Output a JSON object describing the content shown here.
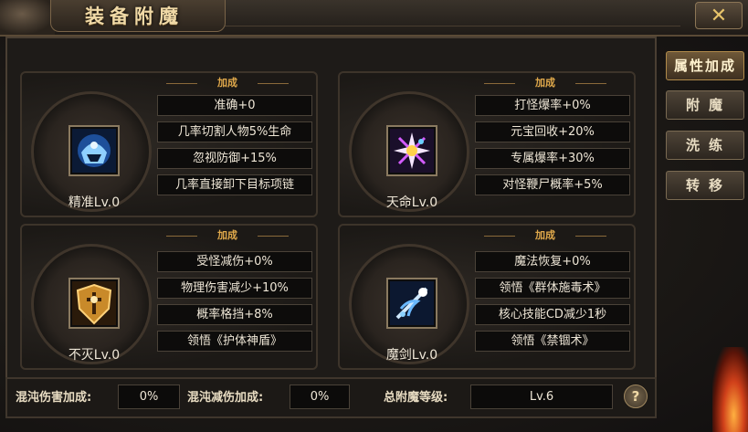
{
  "window": {
    "title": "装备附魔",
    "close_icon": "close-x-icon"
  },
  "side_tabs": [
    {
      "label": "属性加成",
      "active": true
    },
    {
      "label": "附魔",
      "active": false
    },
    {
      "label": "洗练",
      "active": false
    },
    {
      "label": "转移",
      "active": false
    }
  ],
  "panels": [
    {
      "header": "加成",
      "name": "精准Lv.0",
      "icon": "precision-helmet-icon",
      "stats": [
        "准确+0",
        "几率切割人物5%生命",
        "忽视防御+15%",
        "几率直接卸下目标项链"
      ]
    },
    {
      "header": "加成",
      "name": "天命Lv.0",
      "icon": "destiny-star-icon",
      "stats": [
        "打怪爆率+0%",
        "元宝回收+20%",
        "专属爆率+30%",
        "对怪鞭尸概率+5%"
      ]
    },
    {
      "header": "加成",
      "name": "不灭Lv.0",
      "icon": "immortal-shield-icon",
      "stats": [
        "受怪减伤+0%",
        "物理伤害减少+10%",
        "概率格挡+8%",
        "领悟《护体神盾》"
      ]
    },
    {
      "header": "加成",
      "name": "魔剑Lv.0",
      "icon": "magic-sword-icon",
      "stats": [
        "魔法恢复+0%",
        "领悟《群体施毒术》",
        "核心技能CD减少1秒",
        "领悟《禁锢术》"
      ]
    }
  ],
  "bottom": {
    "chaos_damage_label": "混沌伤害加成:",
    "chaos_damage_value": "0%",
    "chaos_reduce_label": "混沌减伤加成:",
    "chaos_reduce_value": "0%",
    "total_level_label": "总附魔等级:",
    "total_level_value": "Lv.6",
    "help_label": "?"
  }
}
